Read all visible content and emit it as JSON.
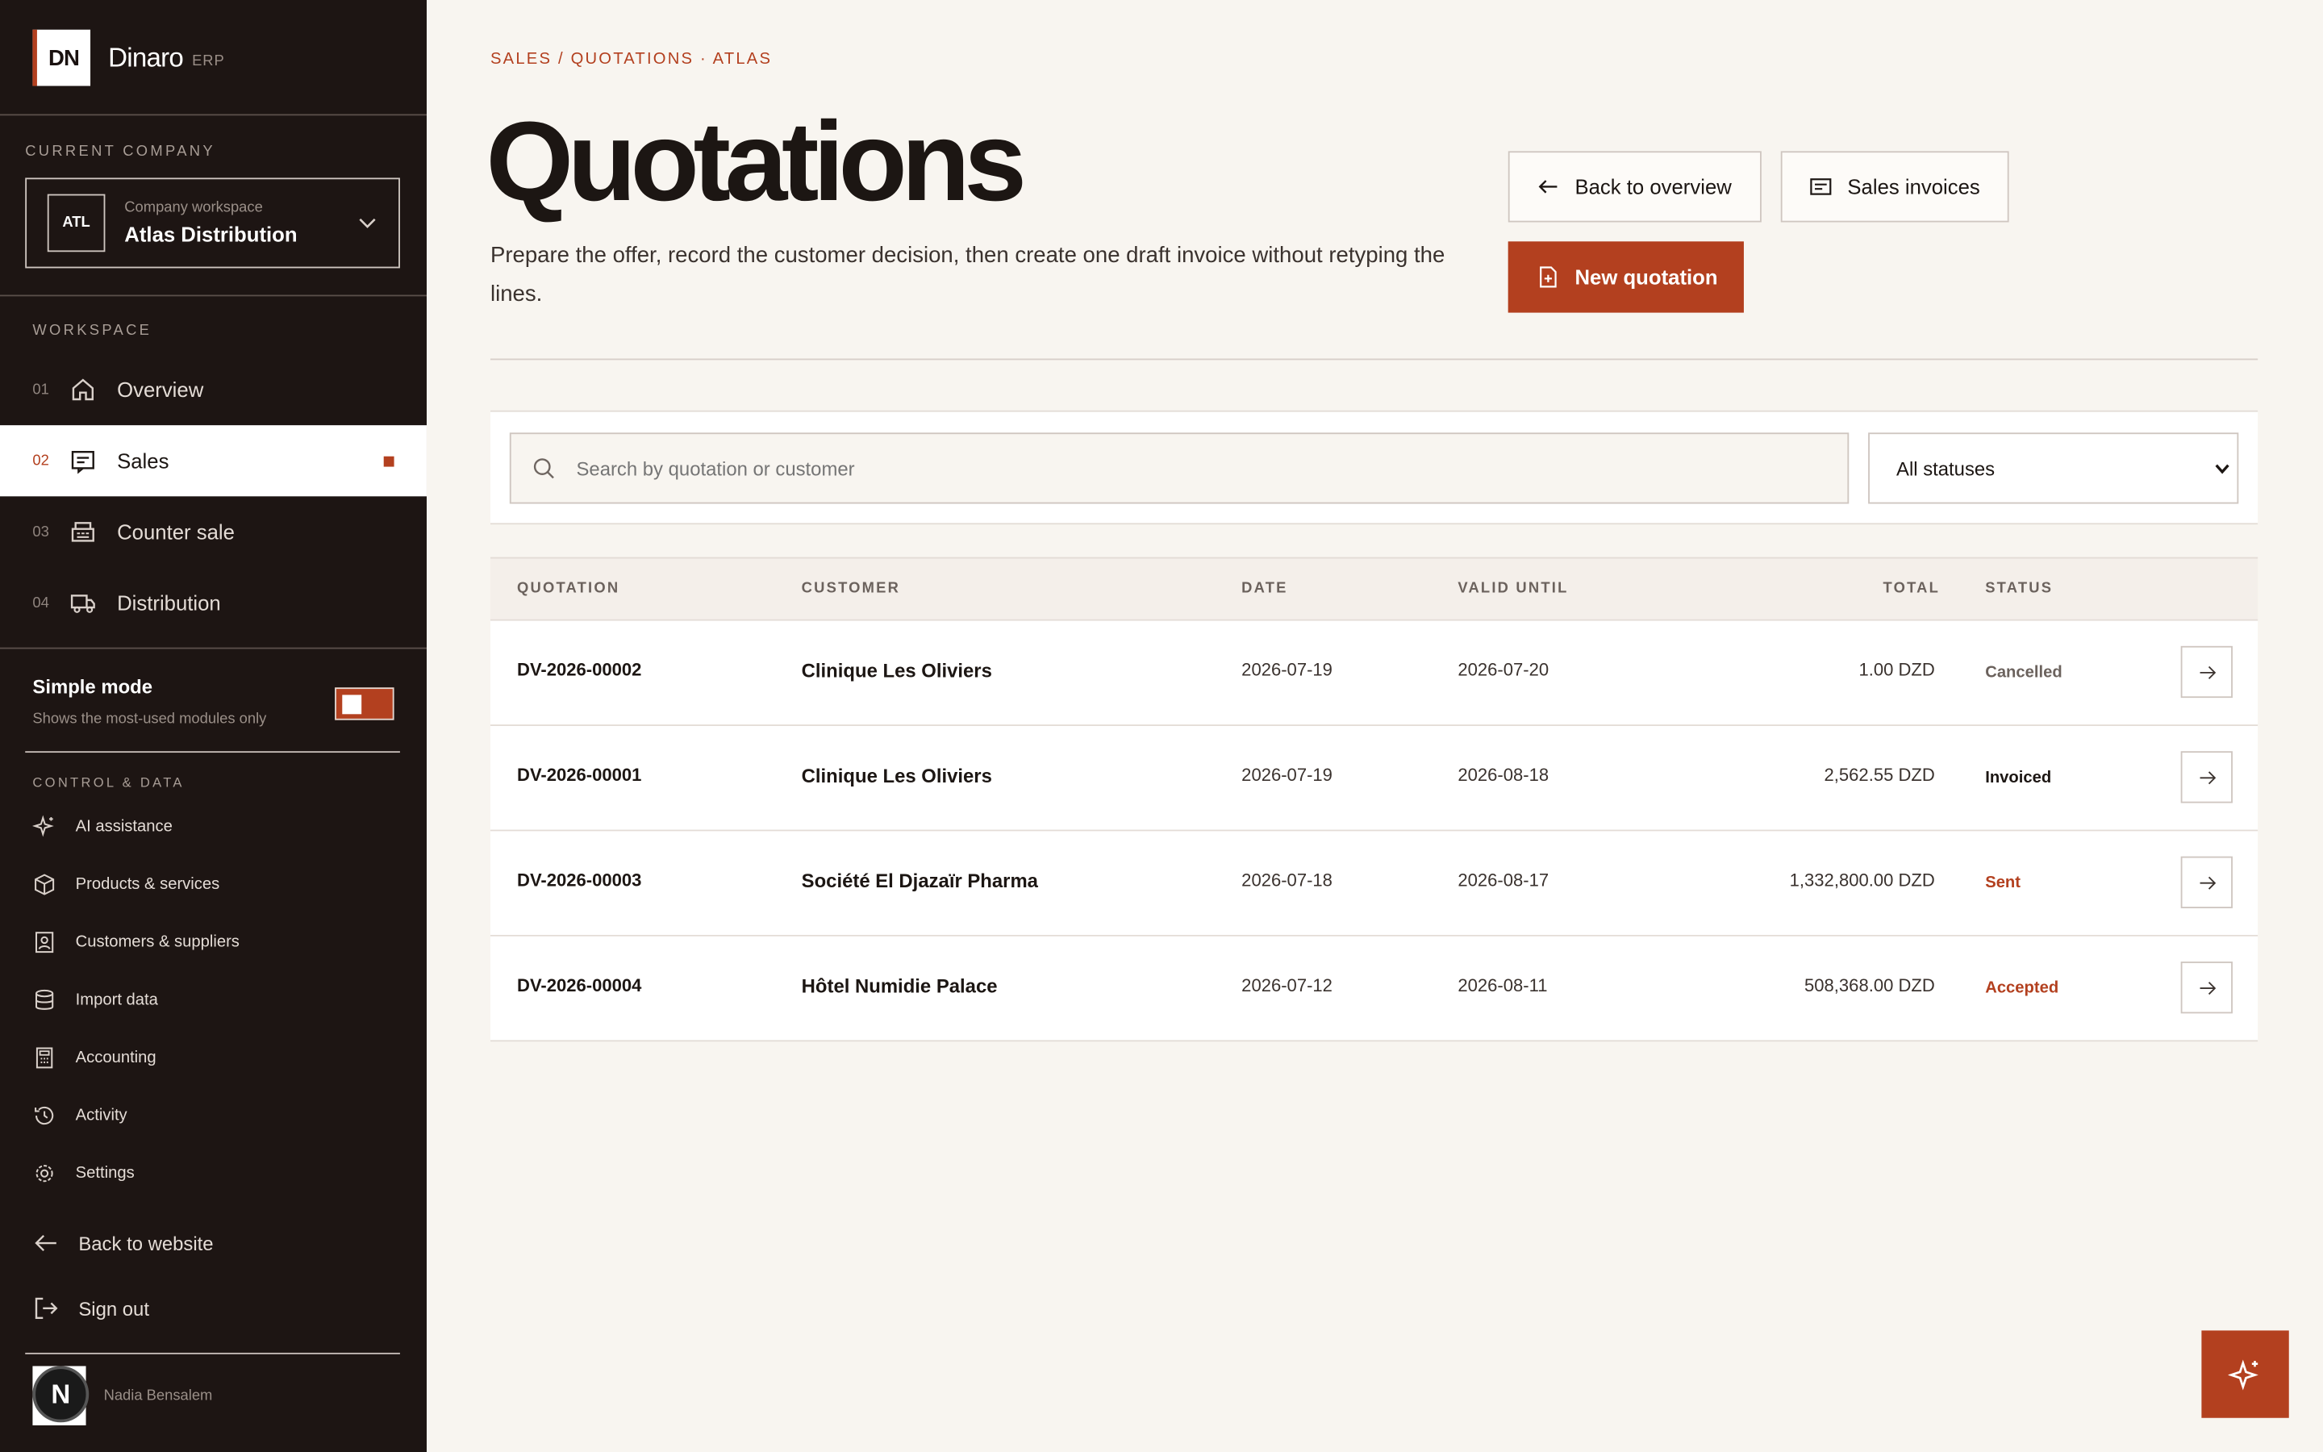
{
  "brand": {
    "logo": "DN",
    "name": "Dinaro",
    "sub": "ERP"
  },
  "company": {
    "section_label": "CURRENT COMPANY",
    "badge": "ATL",
    "caption": "Company workspace",
    "name": "Atlas Distribution"
  },
  "workspace": {
    "label": "WORKSPACE",
    "items": [
      {
        "num": "01",
        "label": "Overview",
        "icon": "home-icon"
      },
      {
        "num": "02",
        "label": "Sales",
        "icon": "receipt-icon",
        "active": true
      },
      {
        "num": "03",
        "label": "Counter sale",
        "icon": "register-icon"
      },
      {
        "num": "04",
        "label": "Distribution",
        "icon": "truck-icon"
      }
    ]
  },
  "simple_mode": {
    "title": "Simple mode",
    "desc": "Shows the most-used modules only",
    "enabled": true
  },
  "control": {
    "label": "CONTROL & DATA",
    "items": [
      {
        "label": "AI assistance",
        "icon": "sparkle-icon"
      },
      {
        "label": "Products & services",
        "icon": "box-icon"
      },
      {
        "label": "Customers & suppliers",
        "icon": "contacts-icon"
      },
      {
        "label": "Import data",
        "icon": "database-icon"
      },
      {
        "label": "Accounting",
        "icon": "calculator-icon"
      },
      {
        "label": "Activity",
        "icon": "history-icon"
      },
      {
        "label": "Settings",
        "icon": "gear-icon"
      }
    ]
  },
  "bottom_links": {
    "back": "Back to website",
    "signout": "Sign out"
  },
  "user": {
    "initial": "N",
    "name": "Nadia Bensalem"
  },
  "main": {
    "breadcrumb": "SALES / QUOTATIONS · ATLAS",
    "title": "Quotations",
    "description": "Prepare the offer, record the customer decision, then create one draft invoice without retyping the lines.",
    "buttons": {
      "back": "Back to overview",
      "invoices": "Sales invoices",
      "new": "New quotation"
    }
  },
  "filters": {
    "search_placeholder": "Search by quotation or customer",
    "status_value": "All statuses"
  },
  "table": {
    "headers": {
      "quotation": "QUOTATION",
      "customer": "CUSTOMER",
      "date": "DATE",
      "valid": "VALID UNTIL",
      "total": "TOTAL",
      "status": "STATUS"
    },
    "rows": [
      {
        "code": "DV-2026-00002",
        "customer": "Clinique Les Oliviers",
        "date": "2026-07-19",
        "valid": "2026-07-20",
        "total": "1.00 DZD",
        "status": "Cancelled",
        "status_color": "#6b625d"
      },
      {
        "code": "DV-2026-00001",
        "customer": "Clinique Les Oliviers",
        "date": "2026-07-19",
        "valid": "2026-08-18",
        "total": "2,562.55 DZD",
        "status": "Invoiced",
        "status_color": "#1c1613"
      },
      {
        "code": "DV-2026-00003",
        "customer": "Société El Djazaïr Pharma",
        "date": "2026-07-18",
        "valid": "2026-08-17",
        "total": "1,332,800.00 DZD",
        "status": "Sent",
        "status_color": "#b3401f"
      },
      {
        "code": "DV-2026-00004",
        "customer": "Hôtel Numidie Palace",
        "date": "2026-07-12",
        "valid": "2026-08-11",
        "total": "508,368.00 DZD",
        "status": "Accepted",
        "status_color": "#b3401f"
      }
    ]
  },
  "colors": {
    "accent": "#b3401f",
    "sidebar": "#1d1513",
    "background": "#f8f5f0"
  }
}
